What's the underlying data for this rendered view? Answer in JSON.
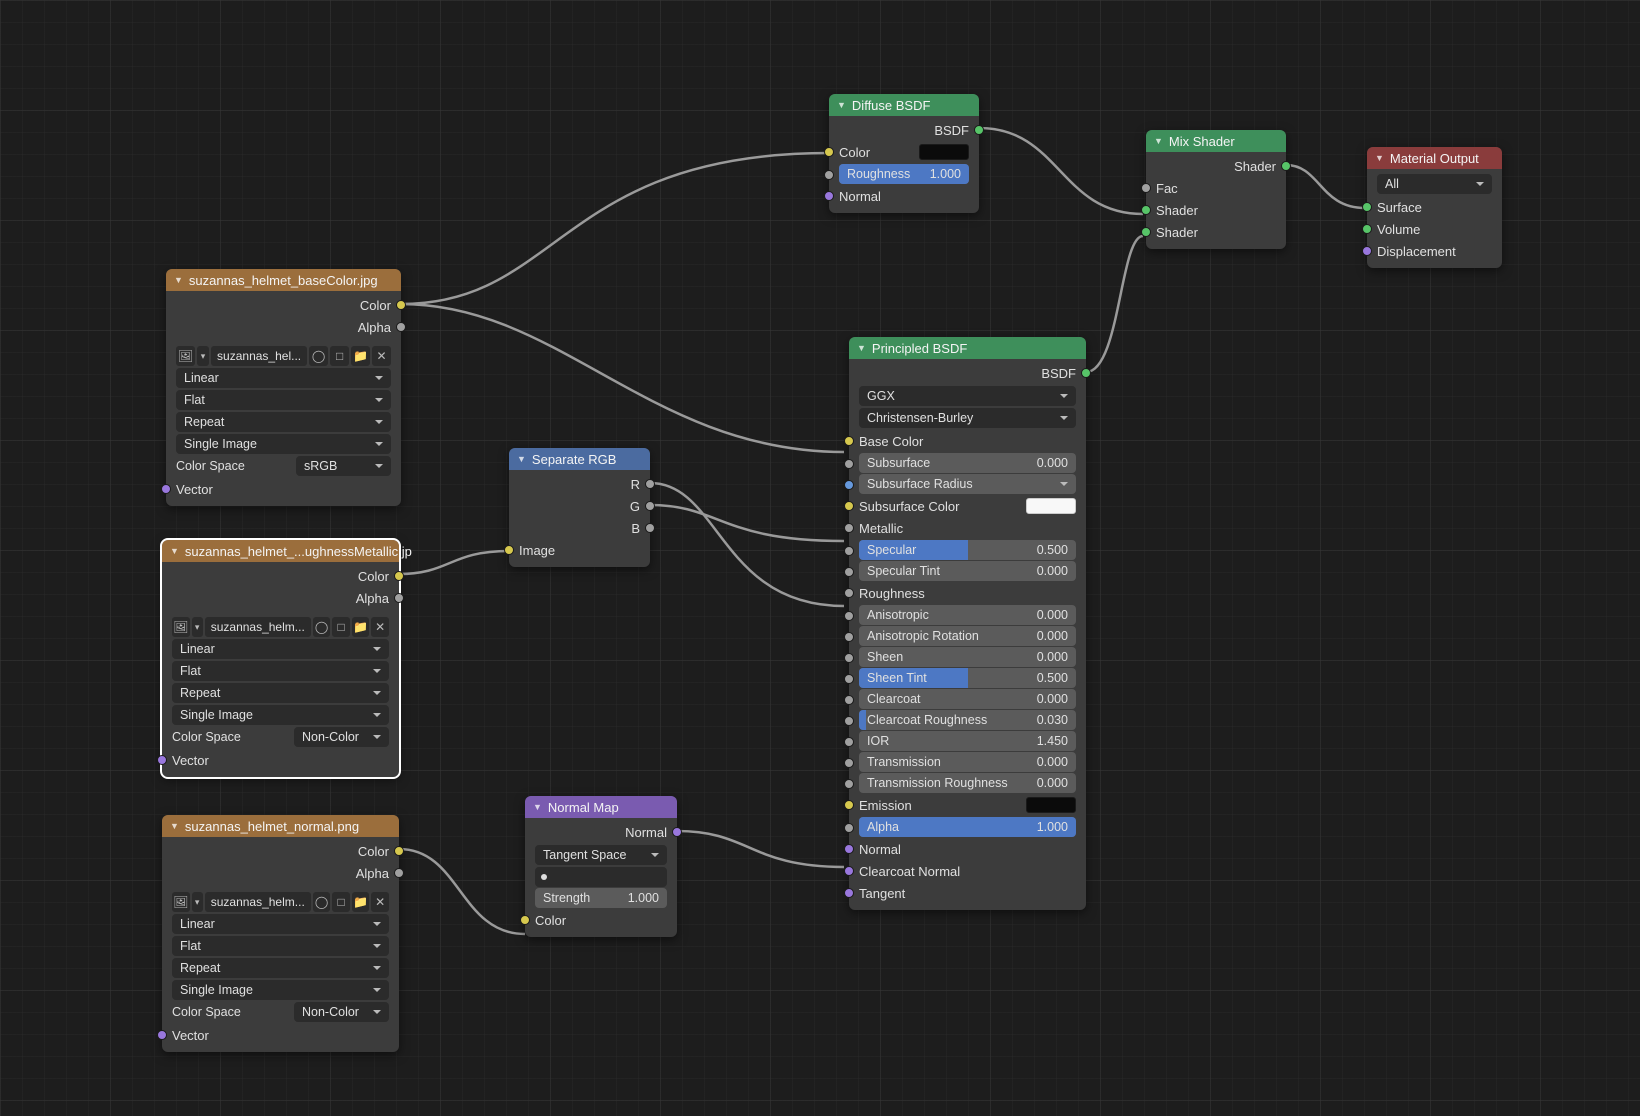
{
  "generic_labels": {
    "color": "Color",
    "alpha": "Alpha",
    "vector": "Vector",
    "color_space": "Color Space",
    "image": "Image",
    "bsdf": "BSDF",
    "shader": "Shader",
    "normal": "Normal"
  },
  "img_nodes": [
    {
      "title": "suzannas_helmet_baseColor.jpg",
      "file": "suzannas_hel...",
      "interp": "Linear",
      "proj": "Flat",
      "ext": "Repeat",
      "source": "Single Image",
      "cspace": "sRGB"
    },
    {
      "title": "suzannas_helmet_...ughnessMetallic.jp",
      "file": "suzannas_helm...",
      "interp": "Linear",
      "proj": "Flat",
      "ext": "Repeat",
      "source": "Single Image",
      "cspace": "Non-Color"
    },
    {
      "title": "suzannas_helmet_normal.png",
      "file": "suzannas_helm...",
      "interp": "Linear",
      "proj": "Flat",
      "ext": "Repeat",
      "source": "Single Image",
      "cspace": "Non-Color"
    }
  ],
  "separate_rgb": {
    "title": "Separate RGB",
    "outs": [
      "R",
      "G",
      "B"
    ]
  },
  "normal_map": {
    "title": "Normal Map",
    "space": "Tangent Space",
    "strength_label": "Strength",
    "strength_value": "1.000"
  },
  "diffuse": {
    "title": "Diffuse BSDF",
    "roughness_label": "Roughness",
    "roughness_value": "1.000"
  },
  "principled": {
    "title": "Principled BSDF",
    "dist": "GGX",
    "sss": "Christensen-Burley",
    "sliders": [
      {
        "label": "Subsurface",
        "value": "0.000",
        "fill": 0
      },
      {
        "label": "Subsurface Radius",
        "value": "",
        "fill": 0,
        "dropdown": true
      },
      {
        "label": "Specular",
        "value": "0.500",
        "fill": 50
      },
      {
        "label": "Specular Tint",
        "value": "0.000",
        "fill": 0
      },
      {
        "label": "Anisotropic",
        "value": "0.000",
        "fill": 0
      },
      {
        "label": "Anisotropic Rotation",
        "value": "0.000",
        "fill": 0
      },
      {
        "label": "Sheen",
        "value": "0.000",
        "fill": 0
      },
      {
        "label": "Sheen Tint",
        "value": "0.500",
        "fill": 50
      },
      {
        "label": "Clearcoat",
        "value": "0.000",
        "fill": 0
      },
      {
        "label": "Clearcoat Roughness",
        "value": "0.030",
        "fill": 3
      },
      {
        "label": "IOR",
        "value": "1.450",
        "fill": 0
      },
      {
        "label": "Transmission",
        "value": "0.000",
        "fill": 0
      },
      {
        "label": "Transmission Roughness",
        "value": "0.000",
        "fill": 0
      },
      {
        "label": "Alpha",
        "value": "1.000",
        "fill": 100
      }
    ],
    "labels": {
      "base_color": "Base Color",
      "subsurface_color": "Subsurface Color",
      "metallic": "Metallic",
      "roughness": "Roughness",
      "emission": "Emission",
      "normal": "Normal",
      "clearcoat_normal": "Clearcoat Normal",
      "tangent": "Tangent"
    }
  },
  "mix": {
    "title": "Mix Shader",
    "fac": "Fac"
  },
  "output": {
    "title": "Material Output",
    "mode": "All",
    "surface": "Surface",
    "volume": "Volume",
    "disp": "Displacement"
  }
}
